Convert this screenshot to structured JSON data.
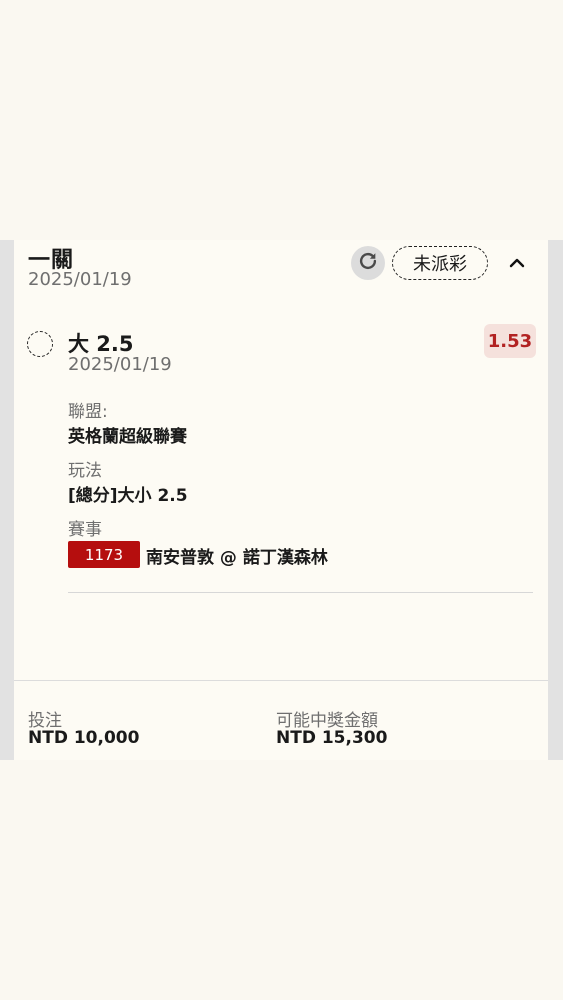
{
  "bet": {
    "type_label": "一關",
    "date": "2025/01/19",
    "status": "未派彩",
    "refresh_icon": "refresh-icon",
    "collapse_icon": "chevron-up-icon"
  },
  "selection": {
    "name": "大 2.5",
    "date": "2025/01/19",
    "odds": "1.53",
    "league_label": "聯盟:",
    "league_value": "英格蘭超級聯賽",
    "market_label": "玩法",
    "market_value": "[總分]大小 2.5",
    "event_label": "賽事",
    "match_id": "1173",
    "match_name": "南安普敦 @ 諾丁漢森林"
  },
  "summary": {
    "stake_label": "投注",
    "stake_value": "NTD 10,000",
    "payout_label": "可能中獎金額",
    "payout_value": "NTD 15,300"
  },
  "colors": {
    "odds_text": "#b22222",
    "odds_bg": "#f5e1dc",
    "match_badge": "#b50e0e",
    "card_bg": "#fdfbf4",
    "page_bg": "#faf8f1"
  }
}
